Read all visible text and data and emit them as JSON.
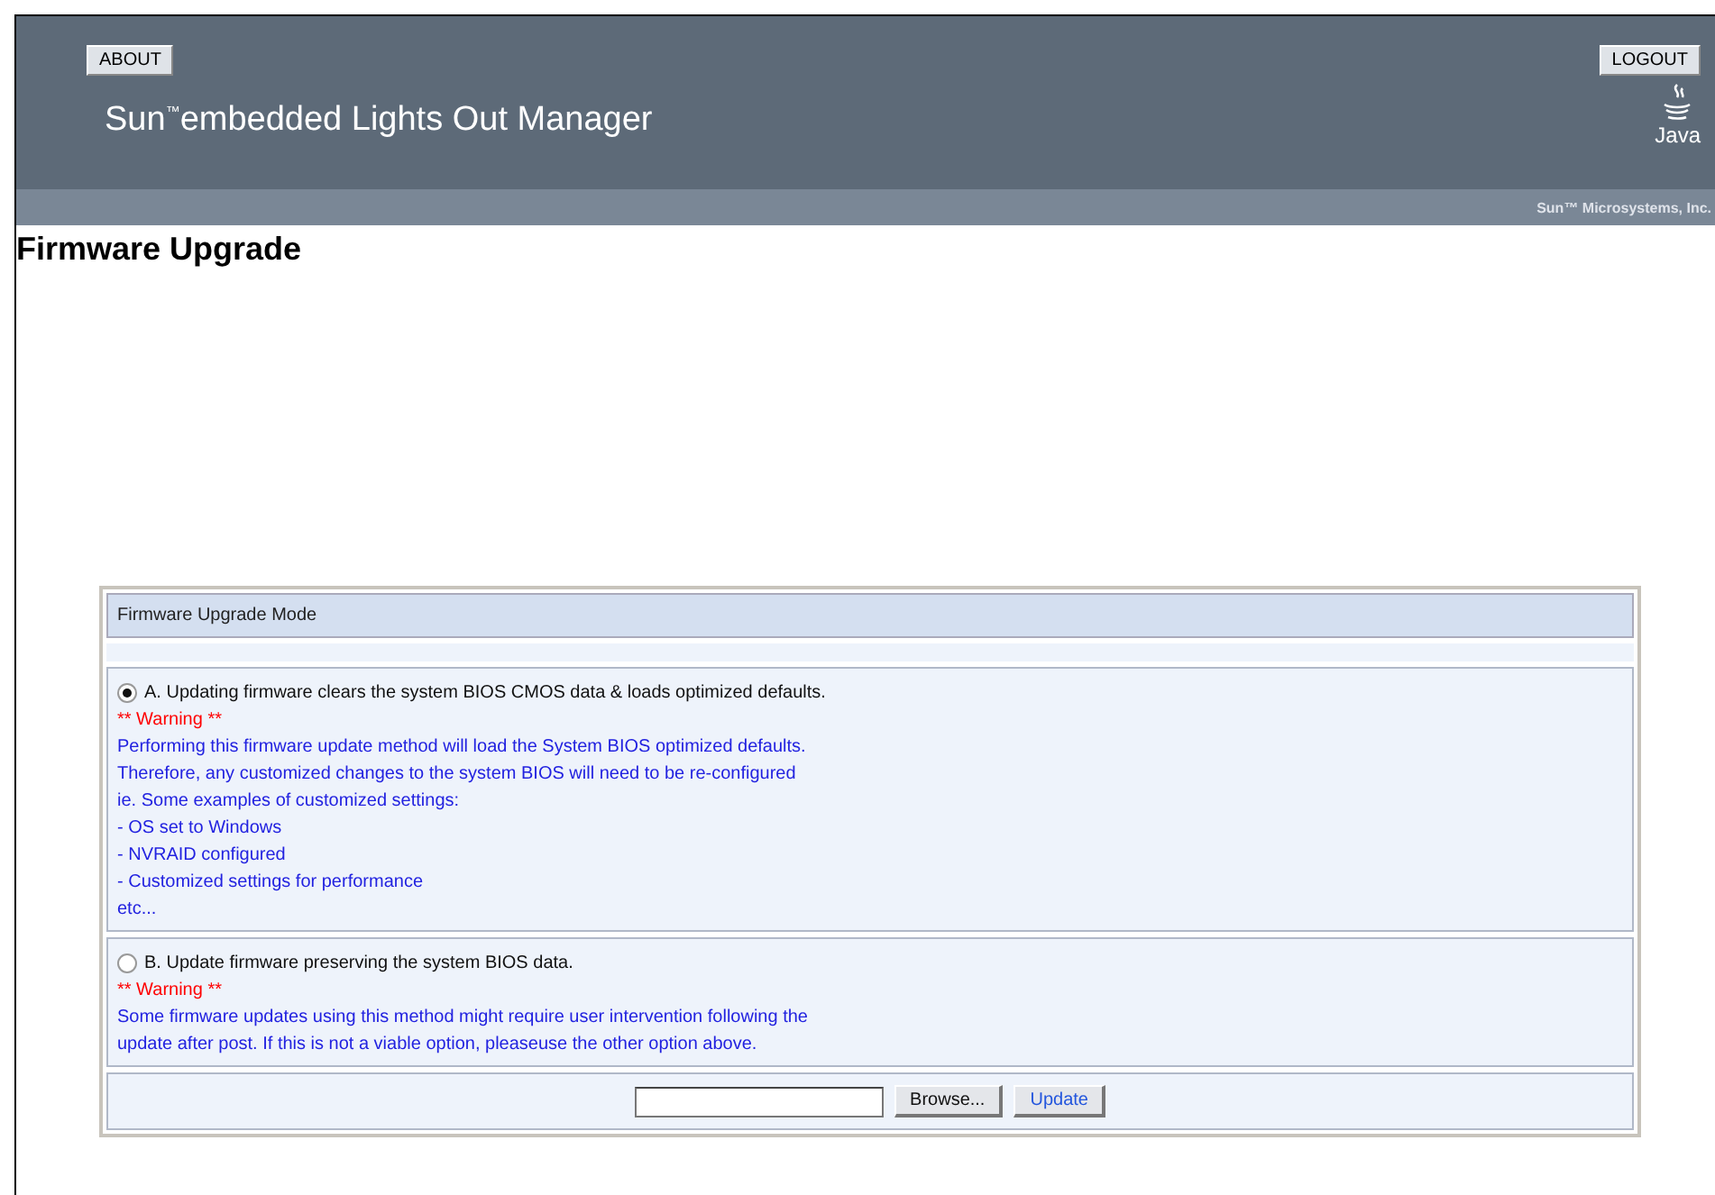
{
  "header": {
    "about_button": "ABOUT",
    "logout_button": "LOGOUT",
    "product_title": "Sun$^{™}$embedded Lights Out Manager",
    "java_logo_text": "Java",
    "company": "Sun™ Microsystems, Inc."
  },
  "page_title": "Firmware Upgrade",
  "panel": {
    "title": "Firmware Upgrade Mode",
    "options": [
      {
        "label": "A. Updating firmware clears the system BIOS CMOS data & loads optimized defaults.",
        "selected": true,
        "warning": "** Warning **",
        "lines": [
          "Performing this firmware update method will load the System BIOS optimized defaults.",
          "Therefore, any customized changes to the system BIOS will need to be re-configured",
          "ie. Some examples of customized settings:",
          "- OS set to Windows",
          "- NVRAID configured",
          "- Customized settings for performance",
          "etc..."
        ]
      },
      {
        "label": "B. Update firmware preserving the system BIOS data.",
        "selected": false,
        "warning": "** Warning **",
        "lines": [
          "Some firmware updates using this method might require user intervention following the",
          "update after post. If this is not a viable option, pleaseuse the other option above."
        ]
      }
    ],
    "browse_button": "Browse...",
    "update_button": "Update"
  }
}
